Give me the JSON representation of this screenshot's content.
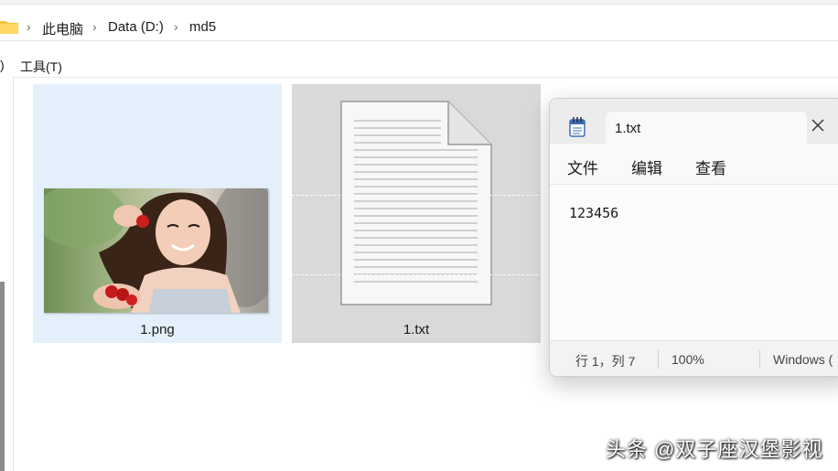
{
  "explorer": {
    "breadcrumb": [
      "此电脑",
      "Data (D:)",
      "md5"
    ],
    "menubar": {
      "partial_left": ")",
      "tools": "工具(T)"
    },
    "files": [
      {
        "name": "1.png",
        "selected": true
      },
      {
        "name": "1.txt",
        "selected": false
      }
    ]
  },
  "notepad": {
    "tab_title": "1.txt",
    "menus": [
      "文件",
      "编辑",
      "查看"
    ],
    "content": "123456",
    "status": {
      "position": "行 1，列 7",
      "zoom": "100%",
      "line_ending": "Windows ("
    }
  },
  "watermark": "头条 @双子座汉堡影视",
  "colors": {
    "selection": "#e3f0fc",
    "tile_gray": "#d9d9d9",
    "folder": "#f4c542"
  }
}
